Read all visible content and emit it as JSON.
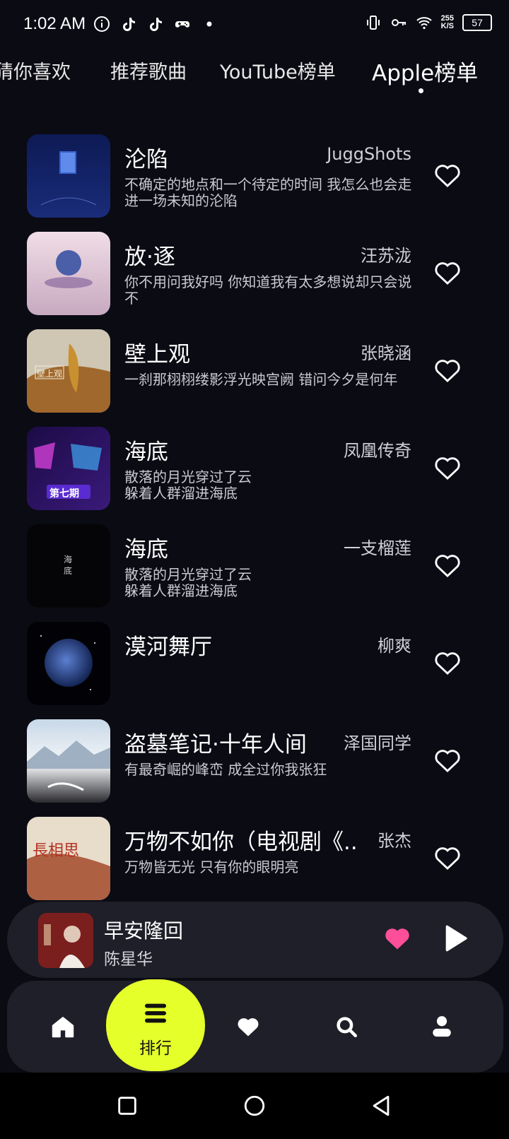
{
  "status_bar": {
    "time": "1:02 AM",
    "icons": [
      "info-icon",
      "tiktok-icon",
      "tiktok-icon",
      "gamepad-icon",
      "dot-icon"
    ],
    "right_icons": [
      "vibrate-icon",
      "key-icon",
      "wifi-icon"
    ],
    "speed_value": "255",
    "speed_unit": "K/S",
    "battery": "57"
  },
  "tabs": [
    {
      "label": "猜你喜欢"
    },
    {
      "label": "推荐歌曲"
    },
    {
      "label": "YouTube榜单"
    },
    {
      "label": "Apple榜单",
      "active": true
    }
  ],
  "songs": [
    {
      "title": "沦陷",
      "artist": "JuggShots",
      "lyric": "不确定的地点和一个待定的时间 我怎么也会走进一场未知的沦陷"
    },
    {
      "title": "放·逐",
      "artist": "汪苏泷",
      "lyric": "你不用问我好吗 你知道我有太多想说却只会说不"
    },
    {
      "title": "壁上观",
      "artist": "张晓涵",
      "lyric": "一刹那栩栩缕影浮光映宫阙 错问今夕是何年"
    },
    {
      "title": "海底",
      "artist": "凤凰传奇",
      "lyric": "散落的月光穿过了云\n躲着人群溜进海底"
    },
    {
      "title": "海底",
      "artist": "一支榴莲",
      "lyric": "散落的月光穿过了云\n躲着人群溜进海底"
    },
    {
      "title": "漠河舞厅",
      "artist": "柳爽",
      "lyric": ""
    },
    {
      "title": "盗墓笔记·十年人间",
      "artist": "泽国同学",
      "lyric": "有最奇崛的峰峦 成全过你我张狂"
    },
    {
      "title": "万物不如你（电视剧《...",
      "artist": "张杰",
      "lyric": "万物皆无光 只有你的眼明亮"
    }
  ],
  "cover_texts": {
    "c3": "壁上观",
    "c4": "第七期",
    "c5": "海底",
    "c8": "長相思"
  },
  "now_playing": {
    "title": "早安隆回",
    "artist": "陈星华",
    "liked": true
  },
  "nav": {
    "active_label": "排行",
    "items": [
      "home-icon",
      "list-icon",
      "heart-icon",
      "search-icon",
      "user-icon"
    ]
  },
  "colors": {
    "background": "#0b0b14",
    "accent": "#e4ff2a",
    "like": "#ff4f9a",
    "panel": "#1e1f28"
  }
}
